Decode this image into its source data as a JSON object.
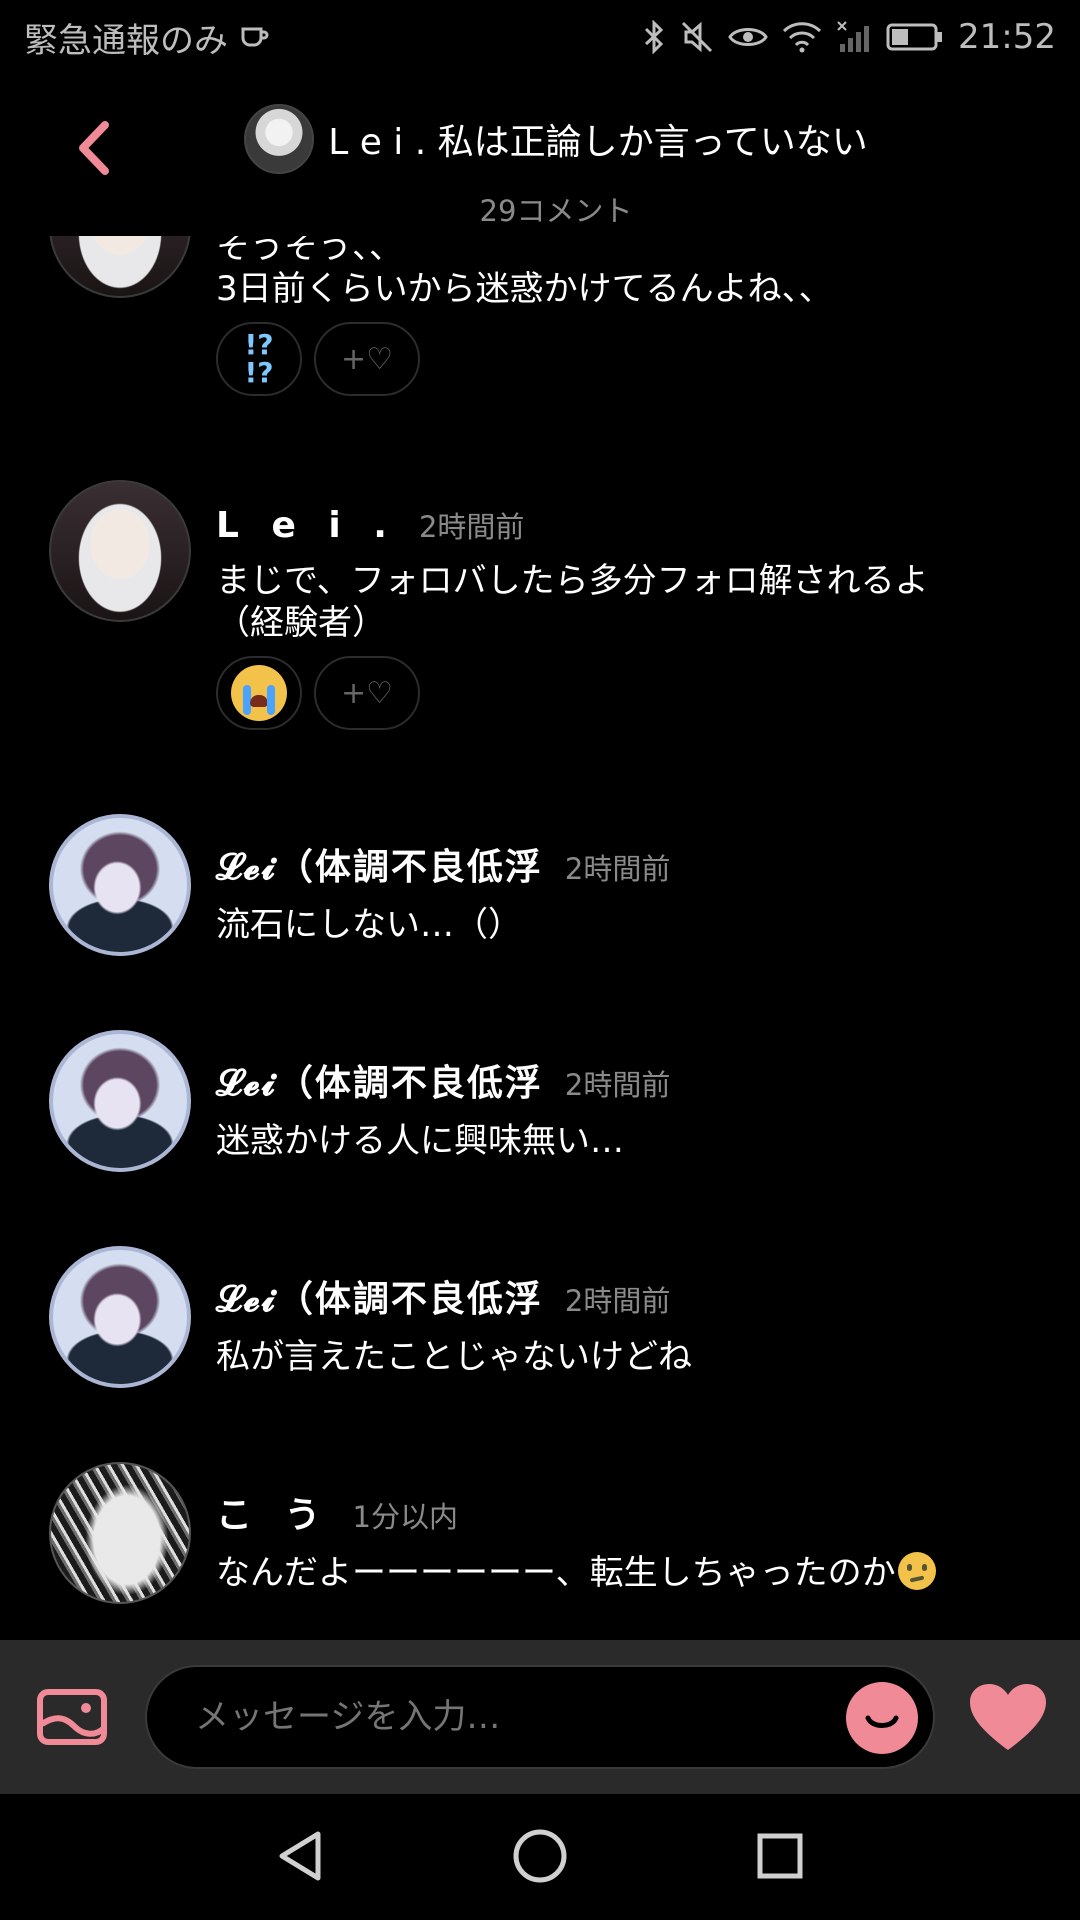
{
  "status_bar": {
    "left_text": "緊急通報のみ",
    "time": "21:52",
    "icons": [
      "coffee-icon",
      "bluetooth-icon",
      "mute-icon",
      "eye-icon",
      "wifi-icon",
      "no-signal-icon",
      "battery-icon"
    ]
  },
  "header": {
    "title": "L e i . 私は正論しか言っていない",
    "subtitle": "29コメント"
  },
  "comments": [
    {
      "name": "",
      "time": "",
      "lines": [
        "そうそう、、",
        "3日前くらいから迷惑かけてるんよね、、"
      ],
      "reaction": "!?!?",
      "avatar": "maid"
    },
    {
      "name": "L e i .",
      "time": "2時間前",
      "lines": [
        "まじで、フォロバしたら多分フォロ解されるよ",
        "（経験者）"
      ],
      "reaction": "crying-face",
      "avatar": "maid"
    },
    {
      "name": "𝓛𝓮𝓲（体調不良低浮",
      "time": "2時間前",
      "lines": [
        "流石にしない…（）"
      ],
      "avatar": "boy"
    },
    {
      "name": "𝓛𝓮𝓲（体調不良低浮",
      "time": "2時間前",
      "lines": [
        "迷惑かける人に興味無い…"
      ],
      "avatar": "boy"
    },
    {
      "name": "𝓛𝓮𝓲（体調不良低浮",
      "time": "2時間前",
      "lines": [
        "私が言えたことじゃないけどね"
      ],
      "avatar": "boy"
    },
    {
      "name": "こ う",
      "time": "1分以内",
      "lines": [
        "なんだよーーーーーー、転生しちゃったのか"
      ],
      "avatar": "mono"
    }
  ],
  "reaction_add_label": "+♡",
  "qmark": {
    "a": "!?",
    "b": "!?"
  },
  "input": {
    "placeholder": "メッセージを入力…"
  },
  "colors": {
    "accent_pink": "#f08a96",
    "background": "#000000",
    "input_bar": "#2a2a2a"
  }
}
